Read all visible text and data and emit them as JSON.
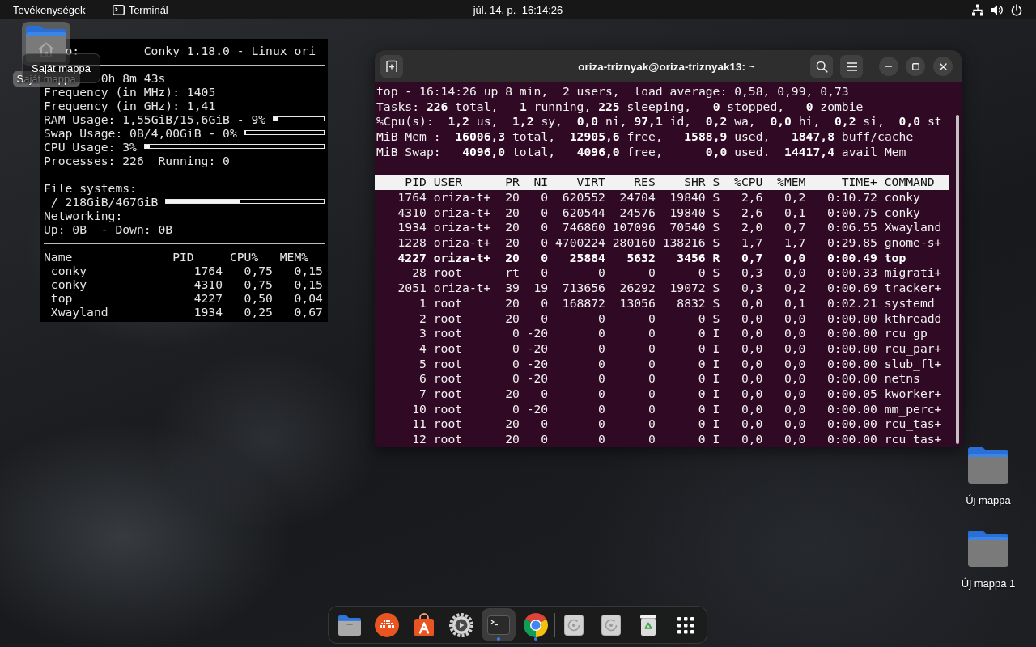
{
  "top_bar": {
    "activities": "Tevékenységek",
    "app_menu": "Terminál",
    "clock": "júl. 14. p.  16:14:26"
  },
  "conky": {
    "lines": [
      {
        "kind": "header",
        "label": "o:",
        "value": "Conky 1.18.0 - Linux ori"
      },
      {
        "kind": "rule"
      },
      {
        "kind": "uptime",
        "text": "0h 8m 43s"
      },
      {
        "kind": "text",
        "text": "Frequency (in MHz): 1405"
      },
      {
        "kind": "text",
        "text": "Frequency (in GHz): 1,41"
      },
      {
        "kind": "bar",
        "text": "RAM Usage: 1,55GiB/15,6GiB - 9%",
        "level": 0.09
      },
      {
        "kind": "bar",
        "text": "Swap Usage: 0B/4,00GiB - 0%",
        "level": 0
      },
      {
        "kind": "bar",
        "text": "CPU Usage: 3%",
        "level": 0.03
      },
      {
        "kind": "text",
        "text": "Processes: 226  Running: 0"
      },
      {
        "kind": "rule"
      },
      {
        "kind": "text",
        "text": "File systems:"
      },
      {
        "kind": "mount",
        "text": "/ 218GiB/467GiB",
        "level": 0.47
      },
      {
        "kind": "text",
        "text": "Networking:"
      },
      {
        "kind": "text",
        "text": "Up: 0B  - Down: 0B"
      },
      {
        "kind": "rule"
      }
    ],
    "processes": {
      "columns": [
        "Name",
        "PID",
        "CPU%",
        "MEM%"
      ],
      "rows": [
        [
          "conky",
          "1764",
          "0,75",
          "0,15"
        ],
        [
          "conky",
          "4310",
          "0,75",
          "0,15"
        ],
        [
          "top",
          "4227",
          "0,50",
          "0,04"
        ],
        [
          "Xwayland",
          "1934",
          "0,25",
          "0,67"
        ]
      ]
    }
  },
  "desktop_icons": [
    {
      "kind": "home",
      "label": "Saját mappa",
      "selected": true
    },
    {
      "kind": "folder",
      "label": "Új mappa",
      "selected": false
    },
    {
      "kind": "folder",
      "label": "Új mappa 1",
      "selected": false
    }
  ],
  "tooltip": "Saját mappa",
  "terminal": {
    "title": "oriza-triznyak@oriza-triznyak13: ~",
    "summary": [
      "top - 16:14:26 up 8 min,  2 users,  load average: 0,58, 0,99, 0,73",
      "Tasks: **226** total,   **1** running, **225** sleeping,   **0** stopped,   **0** zombie",
      "%Cpu(s):  **1,2** us,  **1,2** sy,  **0,0** ni, **97,1** id,  **0,2** wa,  **0,0** hi,  **0,2** si,  **0,0** st",
      "MiB Mem :  **16006,3** total,  **12905,6** free,   **1588,9** used,   **1847,8** buff/cache",
      "MiB Swap:   **4096,0** total,   **4096,0** free,      **0,0** used.  **14417,4** avail Mem"
    ],
    "table": {
      "columns": [
        "PID",
        "USER",
        "PR",
        "NI",
        "VIRT",
        "RES",
        "SHR",
        "S",
        "%CPU",
        "%MEM",
        "TIME+",
        "COMMAND"
      ],
      "rows": [
        {
          "cells": [
            "1764",
            "oriza-t+",
            "20",
            "0",
            "620552",
            "24704",
            "19840",
            "S",
            "2,6",
            "0,2",
            "0:10.72",
            "conky"
          ],
          "highlighted": false
        },
        {
          "cells": [
            "4310",
            "oriza-t+",
            "20",
            "0",
            "620544",
            "24576",
            "19840",
            "S",
            "2,6",
            "0,1",
            "0:00.75",
            "conky"
          ],
          "highlighted": false
        },
        {
          "cells": [
            "1934",
            "oriza-t+",
            "20",
            "0",
            "746860",
            "107096",
            "70540",
            "S",
            "2,0",
            "0,7",
            "0:06.55",
            "Xwayland"
          ],
          "highlighted": false
        },
        {
          "cells": [
            "1228",
            "oriza-t+",
            "20",
            "0",
            "4700224",
            "280160",
            "138216",
            "S",
            "1,7",
            "1,7",
            "0:29.85",
            "gnome-s+"
          ],
          "highlighted": false
        },
        {
          "cells": [
            "4227",
            "oriza-t+",
            "20",
            "0",
            "25884",
            "5632",
            "3456",
            "R",
            "0,7",
            "0,0",
            "0:00.49",
            "top"
          ],
          "highlighted": true
        },
        {
          "cells": [
            "28",
            "root",
            "rt",
            "0",
            "0",
            "0",
            "0",
            "S",
            "0,3",
            "0,0",
            "0:00.33",
            "migrati+"
          ],
          "highlighted": false
        },
        {
          "cells": [
            "2051",
            "oriza-t+",
            "39",
            "19",
            "713656",
            "26292",
            "19072",
            "S",
            "0,3",
            "0,2",
            "0:00.69",
            "tracker+"
          ],
          "highlighted": false
        },
        {
          "cells": [
            "1",
            "root",
            "20",
            "0",
            "168872",
            "13056",
            "8832",
            "S",
            "0,0",
            "0,1",
            "0:02.21",
            "systemd"
          ],
          "highlighted": false
        },
        {
          "cells": [
            "2",
            "root",
            "20",
            "0",
            "0",
            "0",
            "0",
            "S",
            "0,0",
            "0,0",
            "0:00.00",
            "kthreadd"
          ],
          "highlighted": false
        },
        {
          "cells": [
            "3",
            "root",
            "0",
            "-20",
            "0",
            "0",
            "0",
            "I",
            "0,0",
            "0,0",
            "0:00.00",
            "rcu_gp"
          ],
          "highlighted": false
        },
        {
          "cells": [
            "4",
            "root",
            "0",
            "-20",
            "0",
            "0",
            "0",
            "I",
            "0,0",
            "0,0",
            "0:00.00",
            "rcu_par+"
          ],
          "highlighted": false
        },
        {
          "cells": [
            "5",
            "root",
            "0",
            "-20",
            "0",
            "0",
            "0",
            "I",
            "0,0",
            "0,0",
            "0:00.00",
            "slub_fl+"
          ],
          "highlighted": false
        },
        {
          "cells": [
            "6",
            "root",
            "0",
            "-20",
            "0",
            "0",
            "0",
            "I",
            "0,0",
            "0,0",
            "0:00.00",
            "netns"
          ],
          "highlighted": false
        },
        {
          "cells": [
            "7",
            "root",
            "20",
            "0",
            "0",
            "0",
            "0",
            "I",
            "0,0",
            "0,0",
            "0:00.05",
            "kworker+"
          ],
          "highlighted": false
        },
        {
          "cells": [
            "10",
            "root",
            "0",
            "-20",
            "0",
            "0",
            "0",
            "I",
            "0,0",
            "0,0",
            "0:00.00",
            "mm_perc+"
          ],
          "highlighted": false
        },
        {
          "cells": [
            "11",
            "root",
            "20",
            "0",
            "0",
            "0",
            "0",
            "I",
            "0,0",
            "0,0",
            "0:00.00",
            "rcu_tas+"
          ],
          "highlighted": false
        },
        {
          "cells": [
            "12",
            "root",
            "20",
            "0",
            "0",
            "0",
            "0",
            "I",
            "0,0",
            "0,0",
            "0:00.00",
            "rcu_tas+"
          ],
          "highlighted": false
        }
      ]
    }
  },
  "dock": {
    "apps": [
      {
        "kind": "files",
        "running": false,
        "selected": false
      },
      {
        "kind": "dots",
        "running": false,
        "selected": false
      },
      {
        "kind": "store",
        "running": false,
        "selected": false
      },
      {
        "kind": "settings",
        "running": false,
        "selected": false
      },
      {
        "kind": "terminal",
        "running": true,
        "selected": true
      },
      {
        "kind": "browser",
        "running": true,
        "selected": false
      }
    ],
    "places": [
      {
        "kind": "disc"
      },
      {
        "kind": "disc"
      },
      {
        "kind": "trash"
      }
    ]
  }
}
